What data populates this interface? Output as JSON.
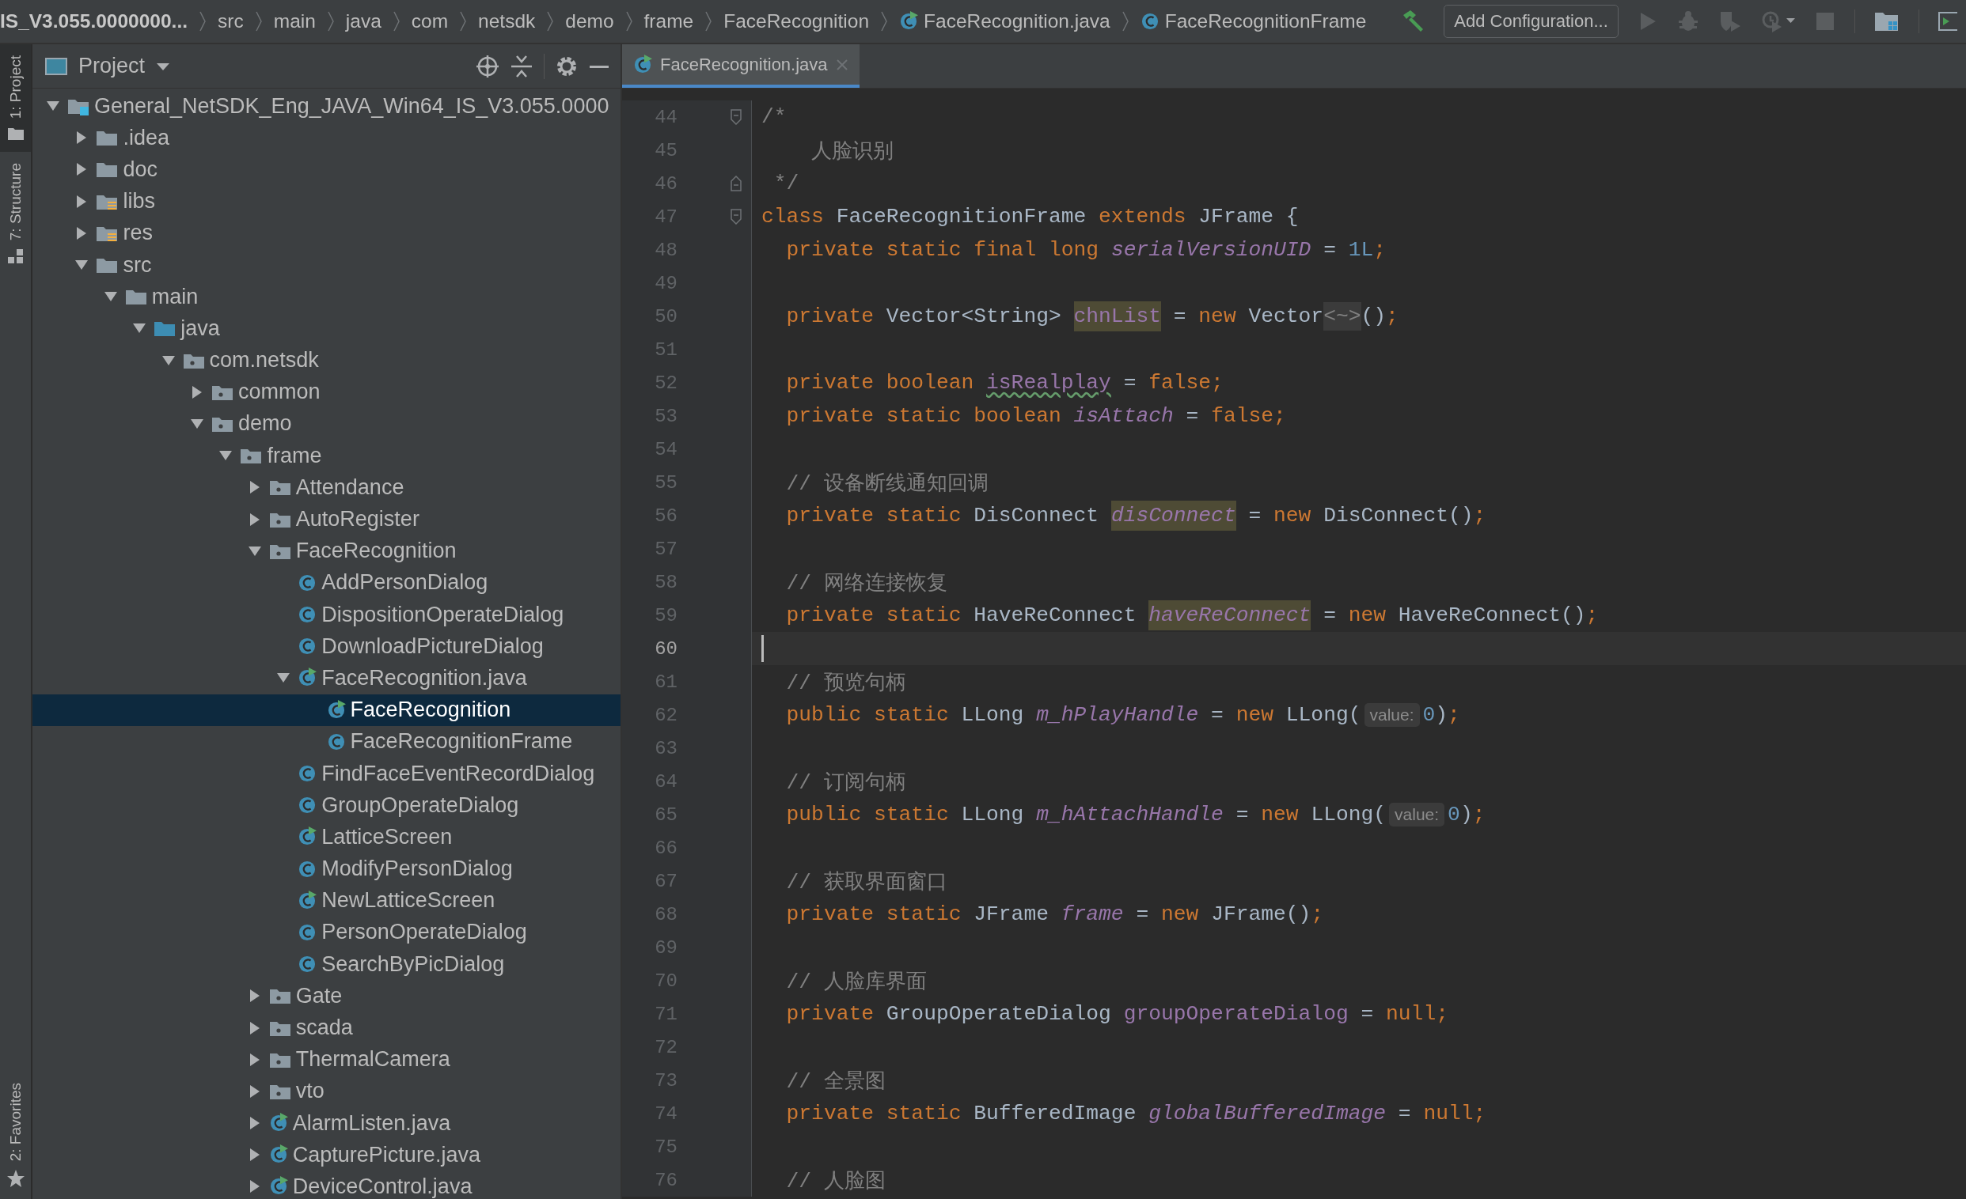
{
  "breadcrumbs": [
    {
      "label": "IS_V3.055.0000000...",
      "kind": "project"
    },
    {
      "label": "src",
      "kind": "folder"
    },
    {
      "label": "main",
      "kind": "folder"
    },
    {
      "label": "java",
      "kind": "folder"
    },
    {
      "label": "com",
      "kind": "folder"
    },
    {
      "label": "netsdk",
      "kind": "folder"
    },
    {
      "label": "demo",
      "kind": "folder"
    },
    {
      "label": "frame",
      "kind": "folder"
    },
    {
      "label": "FaceRecognition",
      "kind": "folder"
    },
    {
      "label": "FaceRecognition.java",
      "kind": "runnable-class"
    },
    {
      "label": "FaceRecognitionFrame",
      "kind": "class"
    }
  ],
  "toolbar": {
    "run_configuration": "Add Configuration..."
  },
  "side_tabs": [
    {
      "label": "1: Project",
      "kind": "project",
      "selected": true
    },
    {
      "label": "7: Structure",
      "kind": "structure",
      "selected": false
    },
    {
      "label": "2: Favorites",
      "kind": "favorites",
      "selected": false
    }
  ],
  "project_panel": {
    "title": "Project",
    "tree": [
      {
        "name": "General_NetSDK_Eng_JAVA_Win64_IS_V3.055.0000",
        "kind": "module",
        "expanded": true,
        "selected": false,
        "children": [
          {
            "name": ".idea",
            "kind": "folder",
            "expanded": false,
            "selected": false
          },
          {
            "name": "doc",
            "kind": "folder",
            "expanded": false,
            "selected": false
          },
          {
            "name": "libs",
            "kind": "lib-folder",
            "expanded": false,
            "selected": false
          },
          {
            "name": "res",
            "kind": "lib-folder",
            "expanded": false,
            "selected": false
          },
          {
            "name": "src",
            "kind": "folder",
            "expanded": true,
            "selected": false,
            "children": [
              {
                "name": "main",
                "kind": "folder",
                "expanded": true,
                "selected": false,
                "children": [
                  {
                    "name": "java",
                    "kind": "source-folder",
                    "expanded": true,
                    "selected": false,
                    "children": [
                      {
                        "name": "com.netsdk",
                        "kind": "package",
                        "expanded": true,
                        "selected": false,
                        "children": [
                          {
                            "name": "common",
                            "kind": "package",
                            "expanded": false,
                            "selected": false
                          },
                          {
                            "name": "demo",
                            "kind": "package",
                            "expanded": true,
                            "selected": false,
                            "children": [
                              {
                                "name": "frame",
                                "kind": "package",
                                "expanded": true,
                                "selected": false,
                                "children": [
                                  {
                                    "name": "Attendance",
                                    "kind": "package",
                                    "expanded": false,
                                    "selected": false
                                  },
                                  {
                                    "name": "AutoRegister",
                                    "kind": "package",
                                    "expanded": false,
                                    "selected": false
                                  },
                                  {
                                    "name": "FaceRecognition",
                                    "kind": "package",
                                    "expanded": true,
                                    "selected": false,
                                    "children": [
                                      {
                                        "name": "AddPersonDialog",
                                        "kind": "class",
                                        "selected": false
                                      },
                                      {
                                        "name": "DispositionOperateDialog",
                                        "kind": "class",
                                        "selected": false
                                      },
                                      {
                                        "name": "DownloadPictureDialog",
                                        "kind": "class",
                                        "selected": false
                                      },
                                      {
                                        "name": "FaceRecognition.java",
                                        "kind": "runnable-class",
                                        "expanded": true,
                                        "selected": false,
                                        "children": [
                                          {
                                            "name": "FaceRecognition",
                                            "kind": "runnable-class",
                                            "selected": true
                                          },
                                          {
                                            "name": "FaceRecognitionFrame",
                                            "kind": "class",
                                            "selected": false
                                          }
                                        ]
                                      },
                                      {
                                        "name": "FindFaceEventRecordDialog",
                                        "kind": "class",
                                        "selected": false
                                      },
                                      {
                                        "name": "GroupOperateDialog",
                                        "kind": "class",
                                        "selected": false
                                      },
                                      {
                                        "name": "LatticeScreen",
                                        "kind": "runnable-class",
                                        "selected": false
                                      },
                                      {
                                        "name": "ModifyPersonDialog",
                                        "kind": "class",
                                        "selected": false
                                      },
                                      {
                                        "name": "NewLatticeScreen",
                                        "kind": "runnable-class",
                                        "selected": false
                                      },
                                      {
                                        "name": "PersonOperateDialog",
                                        "kind": "class",
                                        "selected": false
                                      },
                                      {
                                        "name": "SearchByPicDialog",
                                        "kind": "class",
                                        "selected": false
                                      }
                                    ]
                                  },
                                  {
                                    "name": "Gate",
                                    "kind": "package",
                                    "expanded": false,
                                    "selected": false
                                  },
                                  {
                                    "name": "scada",
                                    "kind": "package",
                                    "expanded": false,
                                    "selected": false
                                  },
                                  {
                                    "name": "ThermalCamera",
                                    "kind": "package",
                                    "expanded": false,
                                    "selected": false
                                  },
                                  {
                                    "name": "vto",
                                    "kind": "package",
                                    "expanded": false,
                                    "selected": false
                                  },
                                  {
                                    "name": "AlarmListen.java",
                                    "kind": "runnable-class",
                                    "expanded": false,
                                    "selected": false
                                  },
                                  {
                                    "name": "CapturePicture.java",
                                    "kind": "runnable-class",
                                    "expanded": false,
                                    "selected": false
                                  },
                                  {
                                    "name": "DeviceControl.java",
                                    "kind": "runnable-class",
                                    "expanded": false,
                                    "selected": false
                                  }
                                ]
                              }
                            ]
                          }
                        ]
                      }
                    ]
                  }
                ]
              }
            ]
          }
        ]
      }
    ]
  },
  "editor": {
    "tabs": [
      {
        "label": "FaceRecognition.java",
        "selected": true
      }
    ],
    "lines": [
      {
        "number": "44",
        "current": false,
        "kind": "fold-start",
        "tokens": [
          {
            "text": "/*",
            "kind": "comment"
          }
        ]
      },
      {
        "number": "45",
        "current": false,
        "kind": "code",
        "tokens": [
          {
            "text": "    人脸识别",
            "kind": "comment"
          }
        ]
      },
      {
        "number": "46",
        "current": false,
        "kind": "fold-end",
        "tokens": [
          {
            "text": " */",
            "kind": "comment"
          }
        ]
      },
      {
        "number": "47",
        "current": false,
        "kind": "fold-start",
        "tokens": [
          {
            "text": "class ",
            "kind": "keyword"
          },
          {
            "text": "FaceRecognitionFrame ",
            "kind": "plain"
          },
          {
            "text": "extends ",
            "kind": "keyword"
          },
          {
            "text": "JFrame {",
            "kind": "plain"
          }
        ]
      },
      {
        "number": "48",
        "current": false,
        "kind": "code",
        "tokens": [
          {
            "text": "  private static final long ",
            "kind": "keyword"
          },
          {
            "text": "serialVersionUID",
            "kind": "static-field"
          },
          {
            "text": " = ",
            "kind": "plain"
          },
          {
            "text": "1L",
            "kind": "number"
          },
          {
            "text": ";",
            "kind": "keyword"
          }
        ]
      },
      {
        "number": "49",
        "current": false,
        "kind": "code"
      },
      {
        "number": "50",
        "current": false,
        "kind": "code",
        "tokens": [
          {
            "text": "  private ",
            "kind": "keyword"
          },
          {
            "text": "Vector<String> ",
            "kind": "plain"
          },
          {
            "text": "chnList",
            "kind": "field-highlight"
          },
          {
            "text": " = ",
            "kind": "plain"
          },
          {
            "text": "new ",
            "kind": "keyword"
          },
          {
            "text": "Vector",
            "kind": "plain"
          },
          {
            "text": "<~>",
            "kind": "folded"
          },
          {
            "text": "()",
            "kind": "plain"
          },
          {
            "text": ";",
            "kind": "keyword"
          }
        ]
      },
      {
        "number": "51",
        "current": false,
        "kind": "code"
      },
      {
        "number": "52",
        "current": false,
        "kind": "code",
        "tokens": [
          {
            "text": "  private boolean ",
            "kind": "keyword"
          },
          {
            "text": "isRealplay",
            "kind": "field-typo"
          },
          {
            "text": " = ",
            "kind": "plain"
          },
          {
            "text": "false;",
            "kind": "keyword"
          }
        ]
      },
      {
        "number": "53",
        "current": false,
        "kind": "code",
        "tokens": [
          {
            "text": "  private static boolean ",
            "kind": "keyword"
          },
          {
            "text": "isAttach",
            "kind": "static-field"
          },
          {
            "text": " = ",
            "kind": "plain"
          },
          {
            "text": "false;",
            "kind": "keyword"
          }
        ]
      },
      {
        "number": "54",
        "current": false,
        "kind": "code"
      },
      {
        "number": "55",
        "current": false,
        "kind": "code",
        "tokens": [
          {
            "text": "  // 设备断线通知回调",
            "kind": "comment"
          }
        ]
      },
      {
        "number": "56",
        "current": false,
        "kind": "code",
        "tokens": [
          {
            "text": "  private static ",
            "kind": "keyword"
          },
          {
            "text": "DisConnect ",
            "kind": "plain"
          },
          {
            "text": "disConnect",
            "kind": "static-field-highlight"
          },
          {
            "text": " = ",
            "kind": "plain"
          },
          {
            "text": "new ",
            "kind": "keyword"
          },
          {
            "text": "DisConnect()",
            "kind": "plain"
          },
          {
            "text": ";",
            "kind": "keyword"
          }
        ]
      },
      {
        "number": "57",
        "current": false,
        "kind": "code"
      },
      {
        "number": "58",
        "current": false,
        "kind": "code",
        "tokens": [
          {
            "text": "  // 网络连接恢复",
            "kind": "comment"
          }
        ]
      },
      {
        "number": "59",
        "current": false,
        "kind": "code",
        "tokens": [
          {
            "text": "  private static ",
            "kind": "keyword"
          },
          {
            "text": "HaveReConnect ",
            "kind": "plain"
          },
          {
            "text": "haveReConnect",
            "kind": "static-field-highlight"
          },
          {
            "text": " = ",
            "kind": "plain"
          },
          {
            "text": "new ",
            "kind": "keyword"
          },
          {
            "text": "HaveReConnect()",
            "kind": "plain"
          },
          {
            "text": ";",
            "kind": "keyword"
          }
        ]
      },
      {
        "number": "60",
        "current": true,
        "kind": "code"
      },
      {
        "number": "61",
        "current": false,
        "kind": "code",
        "tokens": [
          {
            "text": "  // 预览句柄",
            "kind": "comment"
          }
        ]
      },
      {
        "number": "62",
        "current": false,
        "kind": "code",
        "tokens": [
          {
            "text": "  public static ",
            "kind": "keyword"
          },
          {
            "text": "LLong ",
            "kind": "plain"
          },
          {
            "text": "m_hPlayHandle",
            "kind": "static-field"
          },
          {
            "text": " = ",
            "kind": "plain"
          },
          {
            "text": "new ",
            "kind": "keyword"
          },
          {
            "text": "LLong(",
            "kind": "plain"
          },
          {
            "text": "value:",
            "kind": "hint"
          },
          {
            "text": "0",
            "kind": "number"
          },
          {
            "text": ")",
            "kind": "plain"
          },
          {
            "text": ";",
            "kind": "keyword"
          }
        ]
      },
      {
        "number": "63",
        "current": false,
        "kind": "code"
      },
      {
        "number": "64",
        "current": false,
        "kind": "code",
        "tokens": [
          {
            "text": "  // 订阅句柄",
            "kind": "comment"
          }
        ]
      },
      {
        "number": "65",
        "current": false,
        "kind": "code",
        "tokens": [
          {
            "text": "  public static ",
            "kind": "keyword"
          },
          {
            "text": "LLong ",
            "kind": "plain"
          },
          {
            "text": "m_hAttachHandle",
            "kind": "static-field"
          },
          {
            "text": " = ",
            "kind": "plain"
          },
          {
            "text": "new ",
            "kind": "keyword"
          },
          {
            "text": "LLong(",
            "kind": "plain"
          },
          {
            "text": "value:",
            "kind": "hint"
          },
          {
            "text": "0",
            "kind": "number"
          },
          {
            "text": ")",
            "kind": "plain"
          },
          {
            "text": ";",
            "kind": "keyword"
          }
        ]
      },
      {
        "number": "66",
        "current": false,
        "kind": "code"
      },
      {
        "number": "67",
        "current": false,
        "kind": "code",
        "tokens": [
          {
            "text": "  // 获取界面窗口",
            "kind": "comment"
          }
        ]
      },
      {
        "number": "68",
        "current": false,
        "kind": "code",
        "tokens": [
          {
            "text": "  private static ",
            "kind": "keyword"
          },
          {
            "text": "JFrame ",
            "kind": "plain"
          },
          {
            "text": "frame",
            "kind": "static-field"
          },
          {
            "text": " = ",
            "kind": "plain"
          },
          {
            "text": "new ",
            "kind": "keyword"
          },
          {
            "text": "JFrame()",
            "kind": "plain"
          },
          {
            "text": ";",
            "kind": "keyword"
          }
        ]
      },
      {
        "number": "69",
        "current": false,
        "kind": "code"
      },
      {
        "number": "70",
        "current": false,
        "kind": "code",
        "tokens": [
          {
            "text": "  // 人脸库界面",
            "kind": "comment"
          }
        ]
      },
      {
        "number": "71",
        "current": false,
        "kind": "code",
        "tokens": [
          {
            "text": "  private ",
            "kind": "keyword"
          },
          {
            "text": "GroupOperateDialog ",
            "kind": "plain"
          },
          {
            "text": "groupOperateDialog",
            "kind": "field"
          },
          {
            "text": " = ",
            "kind": "plain"
          },
          {
            "text": "null;",
            "kind": "keyword"
          }
        ]
      },
      {
        "number": "72",
        "current": false,
        "kind": "code"
      },
      {
        "number": "73",
        "current": false,
        "kind": "code",
        "tokens": [
          {
            "text": "  // 全景图",
            "kind": "comment"
          }
        ]
      },
      {
        "number": "74",
        "current": false,
        "kind": "code",
        "tokens": [
          {
            "text": "  private static ",
            "kind": "keyword"
          },
          {
            "text": "BufferedImage ",
            "kind": "plain"
          },
          {
            "text": "globalBufferedImage",
            "kind": "static-field"
          },
          {
            "text": " = ",
            "kind": "plain"
          },
          {
            "text": "null;",
            "kind": "keyword"
          }
        ]
      },
      {
        "number": "75",
        "current": false,
        "kind": "code"
      },
      {
        "number": "76",
        "current": false,
        "kind": "code",
        "tokens": [
          {
            "text": "  // 人脸图",
            "kind": "comment"
          }
        ]
      }
    ]
  }
}
